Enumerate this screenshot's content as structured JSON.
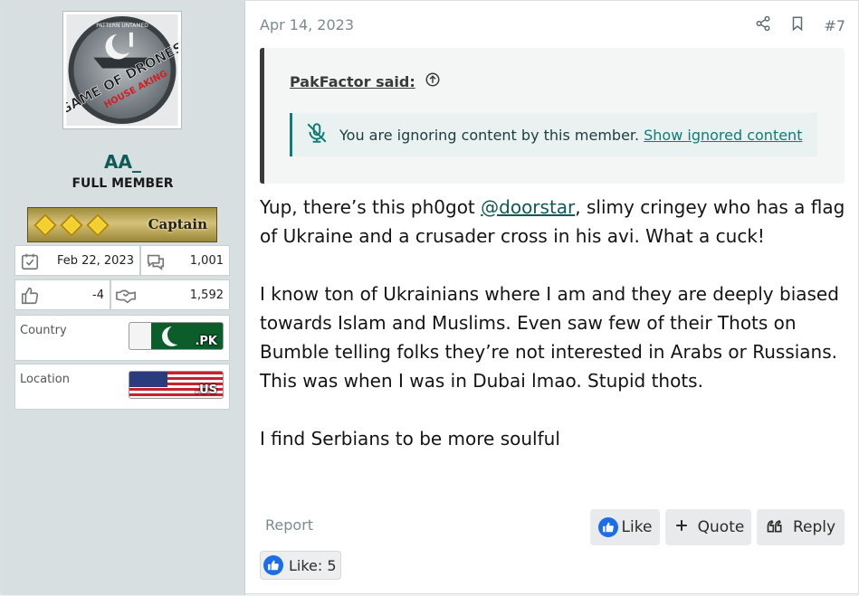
{
  "user": {
    "avatar_logo_text": "GAME OF DRONES",
    "avatar_logo_sub": "HOUSE AKING",
    "avatar_logo_top": "PATTERN UNTAMED",
    "name": "AA_",
    "title": "FULL MEMBER",
    "rank": "Captain",
    "joined": "Feb 22, 2023",
    "messages": "1,001",
    "reaction_score": "-4",
    "points": "1,592",
    "country_label": "Country",
    "country_tld": ".PK",
    "location_label": "Location",
    "location_tld": ".US"
  },
  "post": {
    "date": "Apr 14, 2023",
    "number": "#7",
    "quote_author": "PakFactor said:",
    "ignored_text": "You are ignoring content by this member.",
    "ignored_link": "Show ignored content",
    "p1_before": "Yup, there’s this ph0got ",
    "p1_mention": "@doorstar",
    "p1_after": ", slimy cringey who has a flag of Ukraine and a crusader cross in his avi. What a cuck!",
    "p2": "I know ton of Ukrainians where I am and they are deeply biased towards Islam and Muslims. Even saw few of their Thots on Bumble telling folks they’re not interested in Arabs or Russians. This was when I was in Dubai lmao. Stupid thots.",
    "p3": "I find Serbians to be more soulful"
  },
  "actions": {
    "report": "Report",
    "like": "Like",
    "quote": "Quote",
    "reply": "Reply",
    "likes_summary": "Like: 5"
  },
  "icons": [
    "calendar-check-icon",
    "messages-icon",
    "thumbs-up-icon",
    "handshake-icon",
    "share-icon",
    "bookmark-icon",
    "arrow-up-circle-icon",
    "ignored-mic-icon",
    "plus-icon",
    "reply-quote-icon",
    "like-icon"
  ],
  "colors": {
    "accent": "#0f5a57",
    "link": "#0f7c78",
    "sidebar": "#d7dfe0",
    "like_blue": "#1c6ee8"
  }
}
